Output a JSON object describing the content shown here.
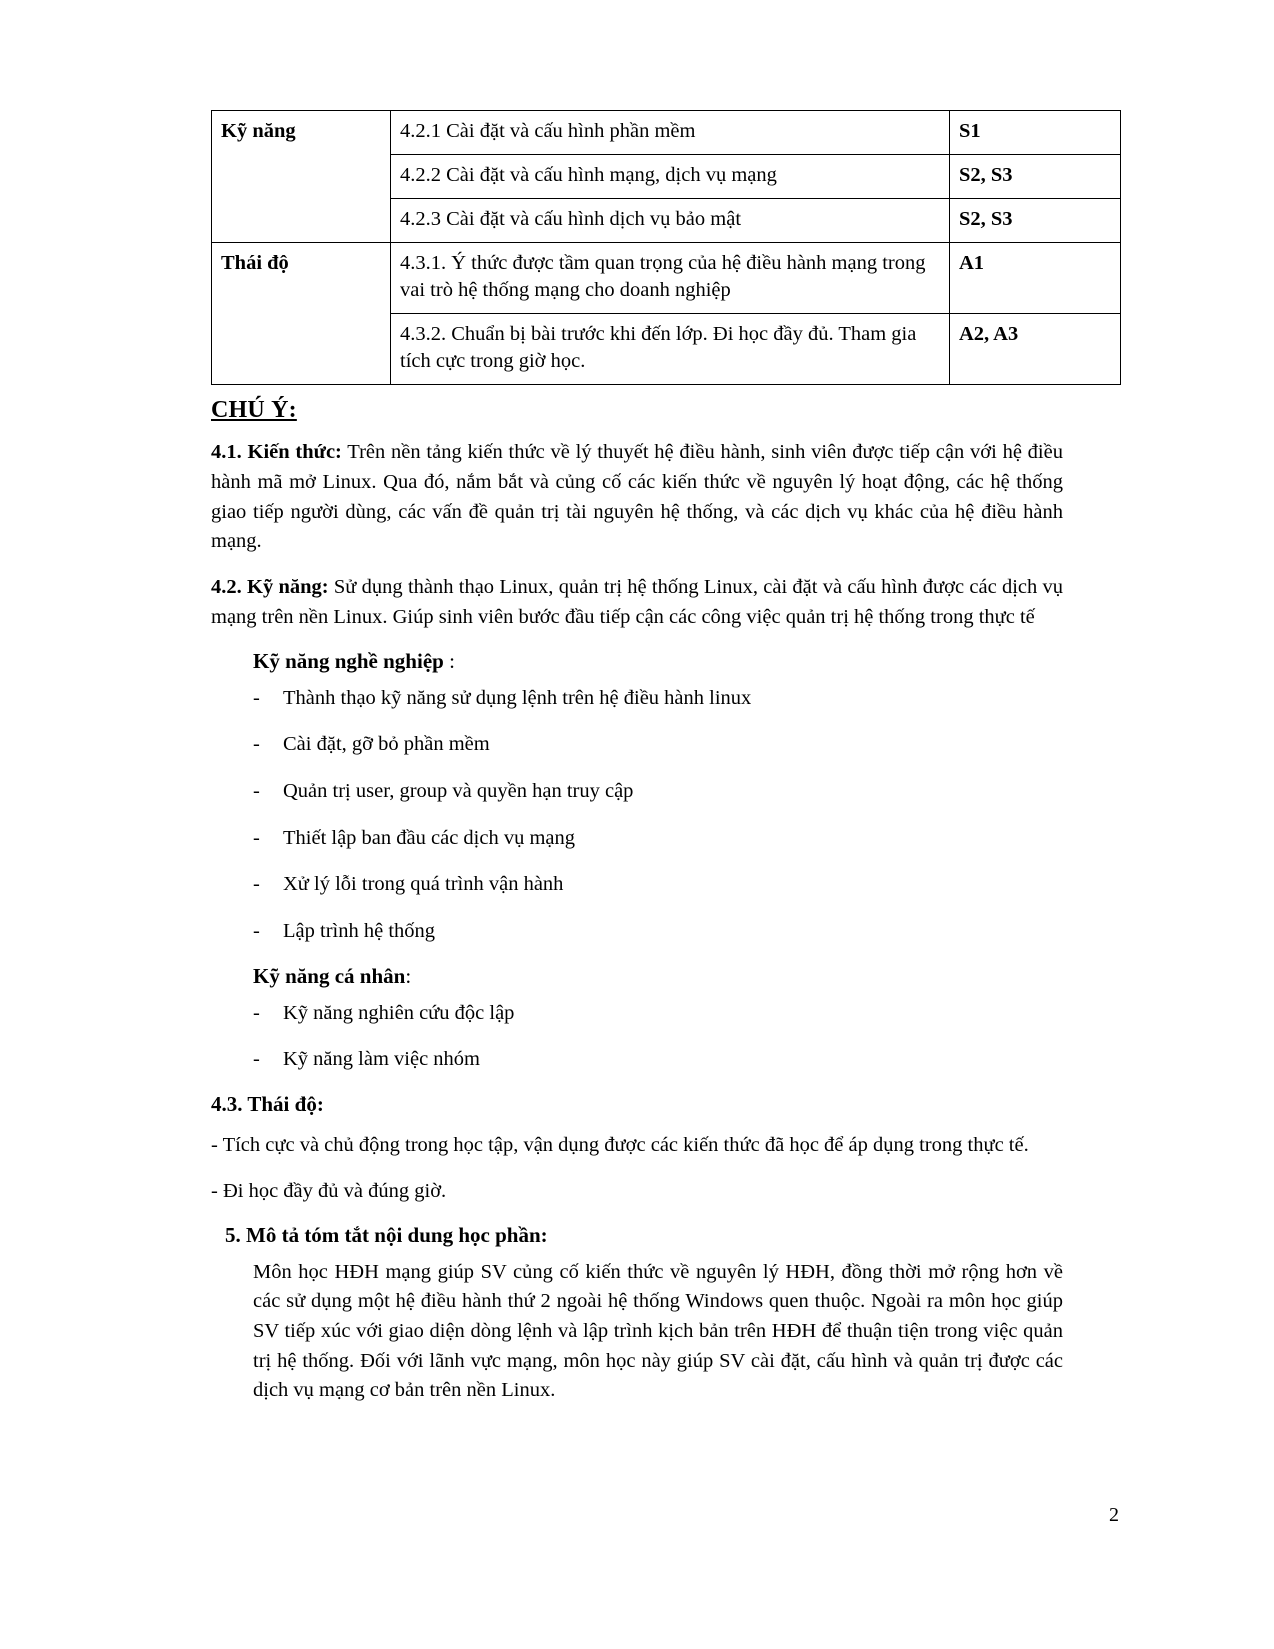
{
  "table": {
    "rows": [
      {
        "category": "Kỹ năng",
        "rowspan": 3,
        "items": [
          {
            "text": "4.2.1 Cài đặt và cấu hình phần mềm",
            "code": "S1"
          },
          {
            "text": "4.2.2 Cài đặt và cấu hình mạng, dịch vụ mạng",
            "code": "S2, S3"
          },
          {
            "text": "4.2.3 Cài đặt và cấu hình dịch vụ bảo mật",
            "code": "S2, S3"
          }
        ]
      },
      {
        "category": "Thái độ",
        "rowspan": 2,
        "items": [
          {
            "text": "4.3.1. Ý thức được tầm quan trọng của hệ điều hành mạng trong vai trò hệ thống mạng cho doanh nghiệp",
            "code": "A1"
          },
          {
            "text": "4.3.2. Chuẩn bị bài trước khi đến lớp. Đi học đầy đủ. Tham gia tích cực trong giờ học.",
            "code": "A2, A3"
          }
        ]
      }
    ]
  },
  "note_heading": "CHÚ Ý:",
  "s41": {
    "label": "4.1. Kiến thức:",
    "body": " Trên nền tảng kiến thức về lý thuyết hệ điều hành, sinh viên được tiếp cận với hệ điều hành mã mở Linux. Qua đó, nắm bắt và củng cố các kiến thức về nguyên lý hoạt động, các hệ thống giao tiếp người dùng, các vấn đề quản trị tài nguyên hệ thống, và các dịch vụ khác của hệ điều hành mạng."
  },
  "s42": {
    "label": "4.2. Kỹ năng:",
    "body": " Sử dụng thành thạo Linux, quản trị hệ thống Linux, cài đặt và cấu hình được các dịch vụ mạng trên nền Linux. Giúp sinh viên bước đầu tiếp cận các công việc quản trị hệ thống trong thực tế",
    "prof_heading": "Kỹ năng nghề nghiệp",
    "prof_heading_suffix": " :",
    "prof_items": [
      "Thành thạo kỹ năng sử dụng lệnh trên hệ điều hành linux",
      "Cài đặt, gỡ bỏ phần mềm",
      "Quản trị user, group và quyền hạn truy cập",
      "Thiết lập ban đầu các dịch vụ mạng",
      "Xử lý lỗi trong quá trình vận hành",
      "Lập trình hệ thống"
    ],
    "personal_heading": "Kỹ năng cá nhân",
    "personal_heading_suffix": ":",
    "personal_items": [
      "Kỹ năng nghiên cứu độc lập",
      "Kỹ năng làm việc nhóm"
    ],
    "dash_marker": "-"
  },
  "s43": {
    "heading": "4.3. Thái độ:",
    "lines": [
      "- Tích cực và chủ động trong học tập, vận dụng được các kiến thức đã học để áp dụng trong thực tế.",
      "- Đi học đầy đủ và đúng giờ."
    ]
  },
  "s5": {
    "heading": "5. Mô tả tóm tắt nội dung học phần:",
    "body": "Môn học HĐH mạng giúp SV củng cố kiến thức về nguyên lý HĐH, đồng thời mở rộng hơn về các sử dụng một hệ điều hành thứ 2 ngoài hệ thống Windows quen thuộc. Ngoài ra môn học giúp SV tiếp xúc với giao diện dòng lệnh và lập trình kịch bản trên HĐH để thuận tiện trong việc quản trị hệ thống. Đối với lãnh vực mạng, môn học này giúp SV cài đặt, cấu hình và quản trị được các dịch vụ mạng cơ bản trên nền Linux."
  },
  "page_number": "2"
}
